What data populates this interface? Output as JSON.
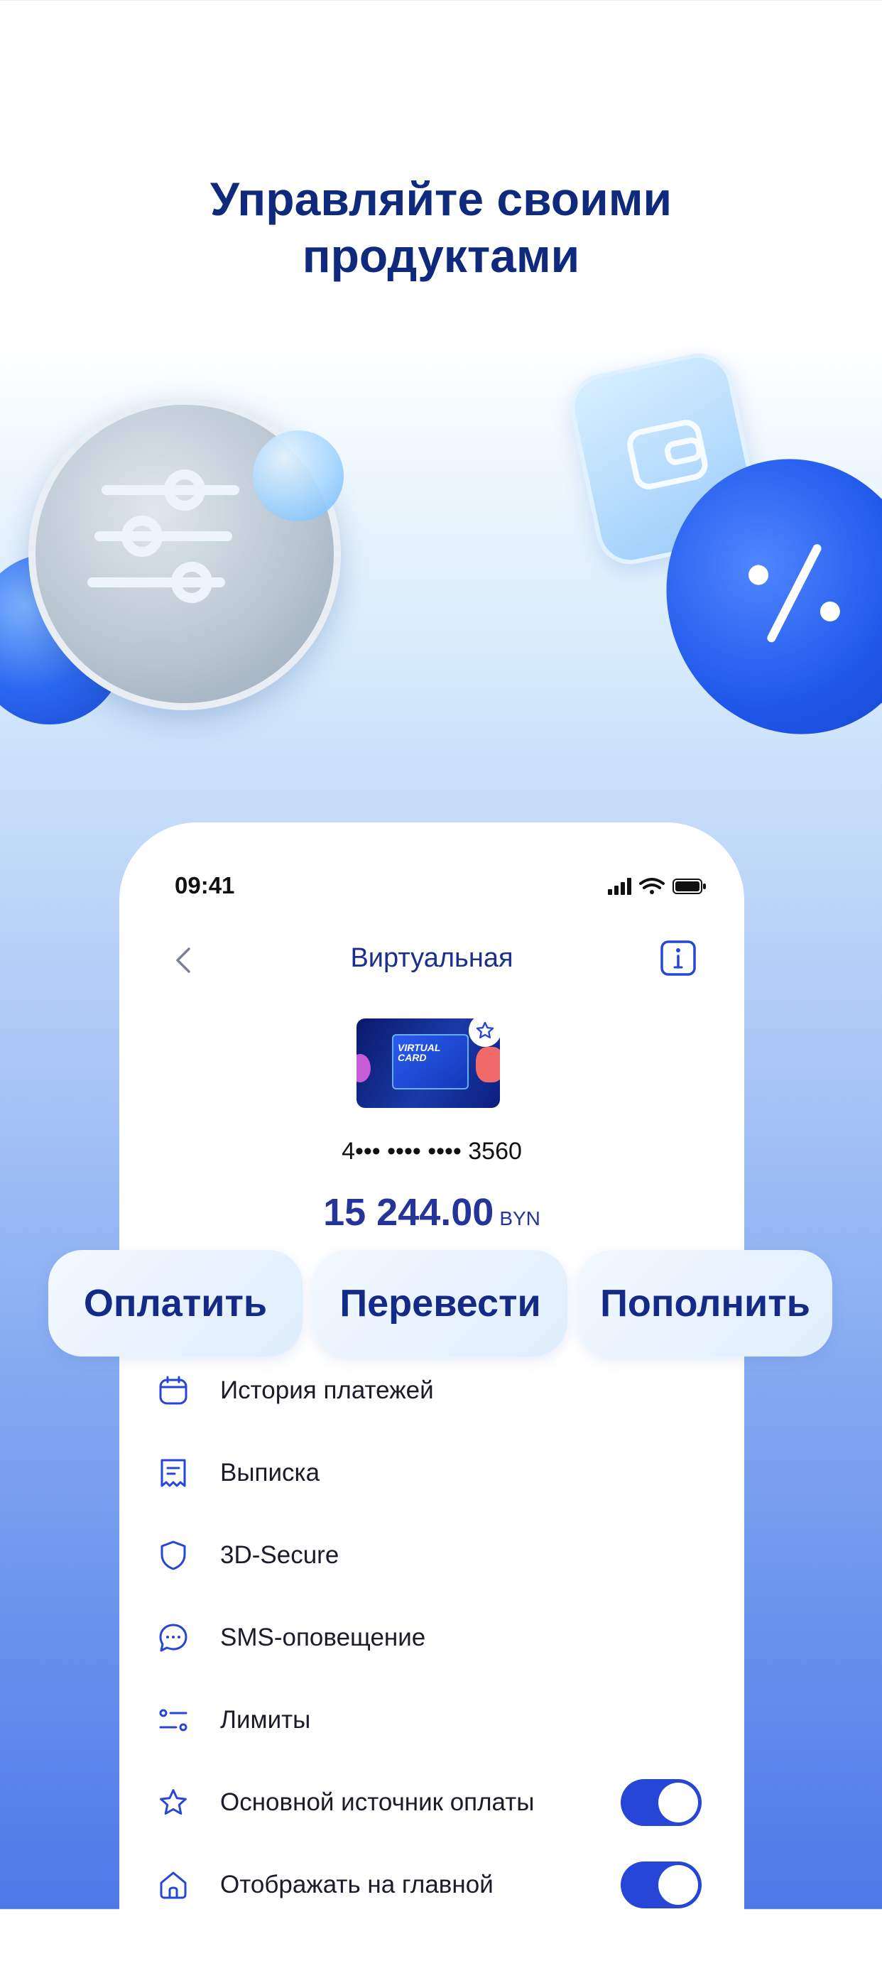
{
  "headline": {
    "line1": "Управляйте своими",
    "line2": "продуктами"
  },
  "status_bar": {
    "time": "09:41"
  },
  "nav": {
    "title": "Виртуальная"
  },
  "card": {
    "image_text_line1": "VIRTUAL",
    "image_text_line2": "CARD",
    "number": "4••• •••• •••• 3560",
    "balance": "15 244.00",
    "currency": "BYN"
  },
  "actions": [
    {
      "label": "Оплатить"
    },
    {
      "label": "Перевести"
    },
    {
      "label": "Пополнить"
    }
  ],
  "menu": [
    {
      "label": "История платежей",
      "icon": "calendar-icon"
    },
    {
      "label": "Выписка",
      "icon": "receipt-icon"
    },
    {
      "label": "3D-Secure",
      "icon": "shield-icon"
    },
    {
      "label": "SMS-оповещение",
      "icon": "chat-icon"
    },
    {
      "label": "Лимиты",
      "icon": "sliders-icon"
    },
    {
      "label": "Основной источник оплаты",
      "icon": "star-icon",
      "toggle": true
    },
    {
      "label": "Отображать на главной",
      "icon": "home-icon",
      "toggle": true
    }
  ],
  "colors": {
    "accent": "#2546d6",
    "title": "#0f2a7d",
    "text_blue": "#24349a"
  }
}
